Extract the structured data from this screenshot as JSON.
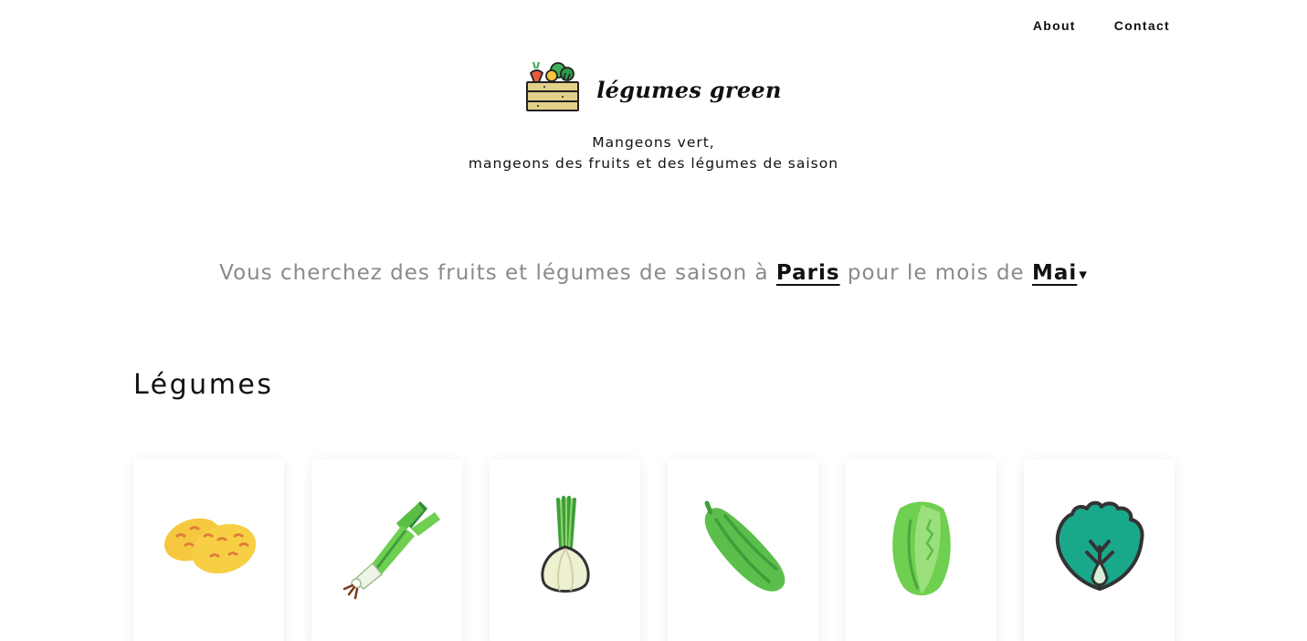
{
  "nav": {
    "about": "About",
    "contact": "Contact"
  },
  "brand": {
    "name": "légumes green",
    "logo_icon": "vegetable-crate-icon"
  },
  "tagline": {
    "line1": "Mangeons vert,",
    "line2": "mangeons des fruits et des légumes de saison"
  },
  "search": {
    "prefix": "Vous cherchez des fruits et légumes de saison à",
    "city": "Paris",
    "middle": "pour le mois de",
    "month": "Mai",
    "caret": "▾"
  },
  "section": {
    "title": "Légumes"
  },
  "cards": [
    {
      "icon": "potato-icon"
    },
    {
      "icon": "leek-icon"
    },
    {
      "icon": "spring-onion-icon"
    },
    {
      "icon": "cucumber-icon"
    },
    {
      "icon": "lettuce-icon"
    },
    {
      "icon": "spinach-icon"
    }
  ],
  "colors": {
    "text": "#111111",
    "muted": "#8a8a8a",
    "green": "#6abf4b",
    "background": "#ffffff"
  }
}
